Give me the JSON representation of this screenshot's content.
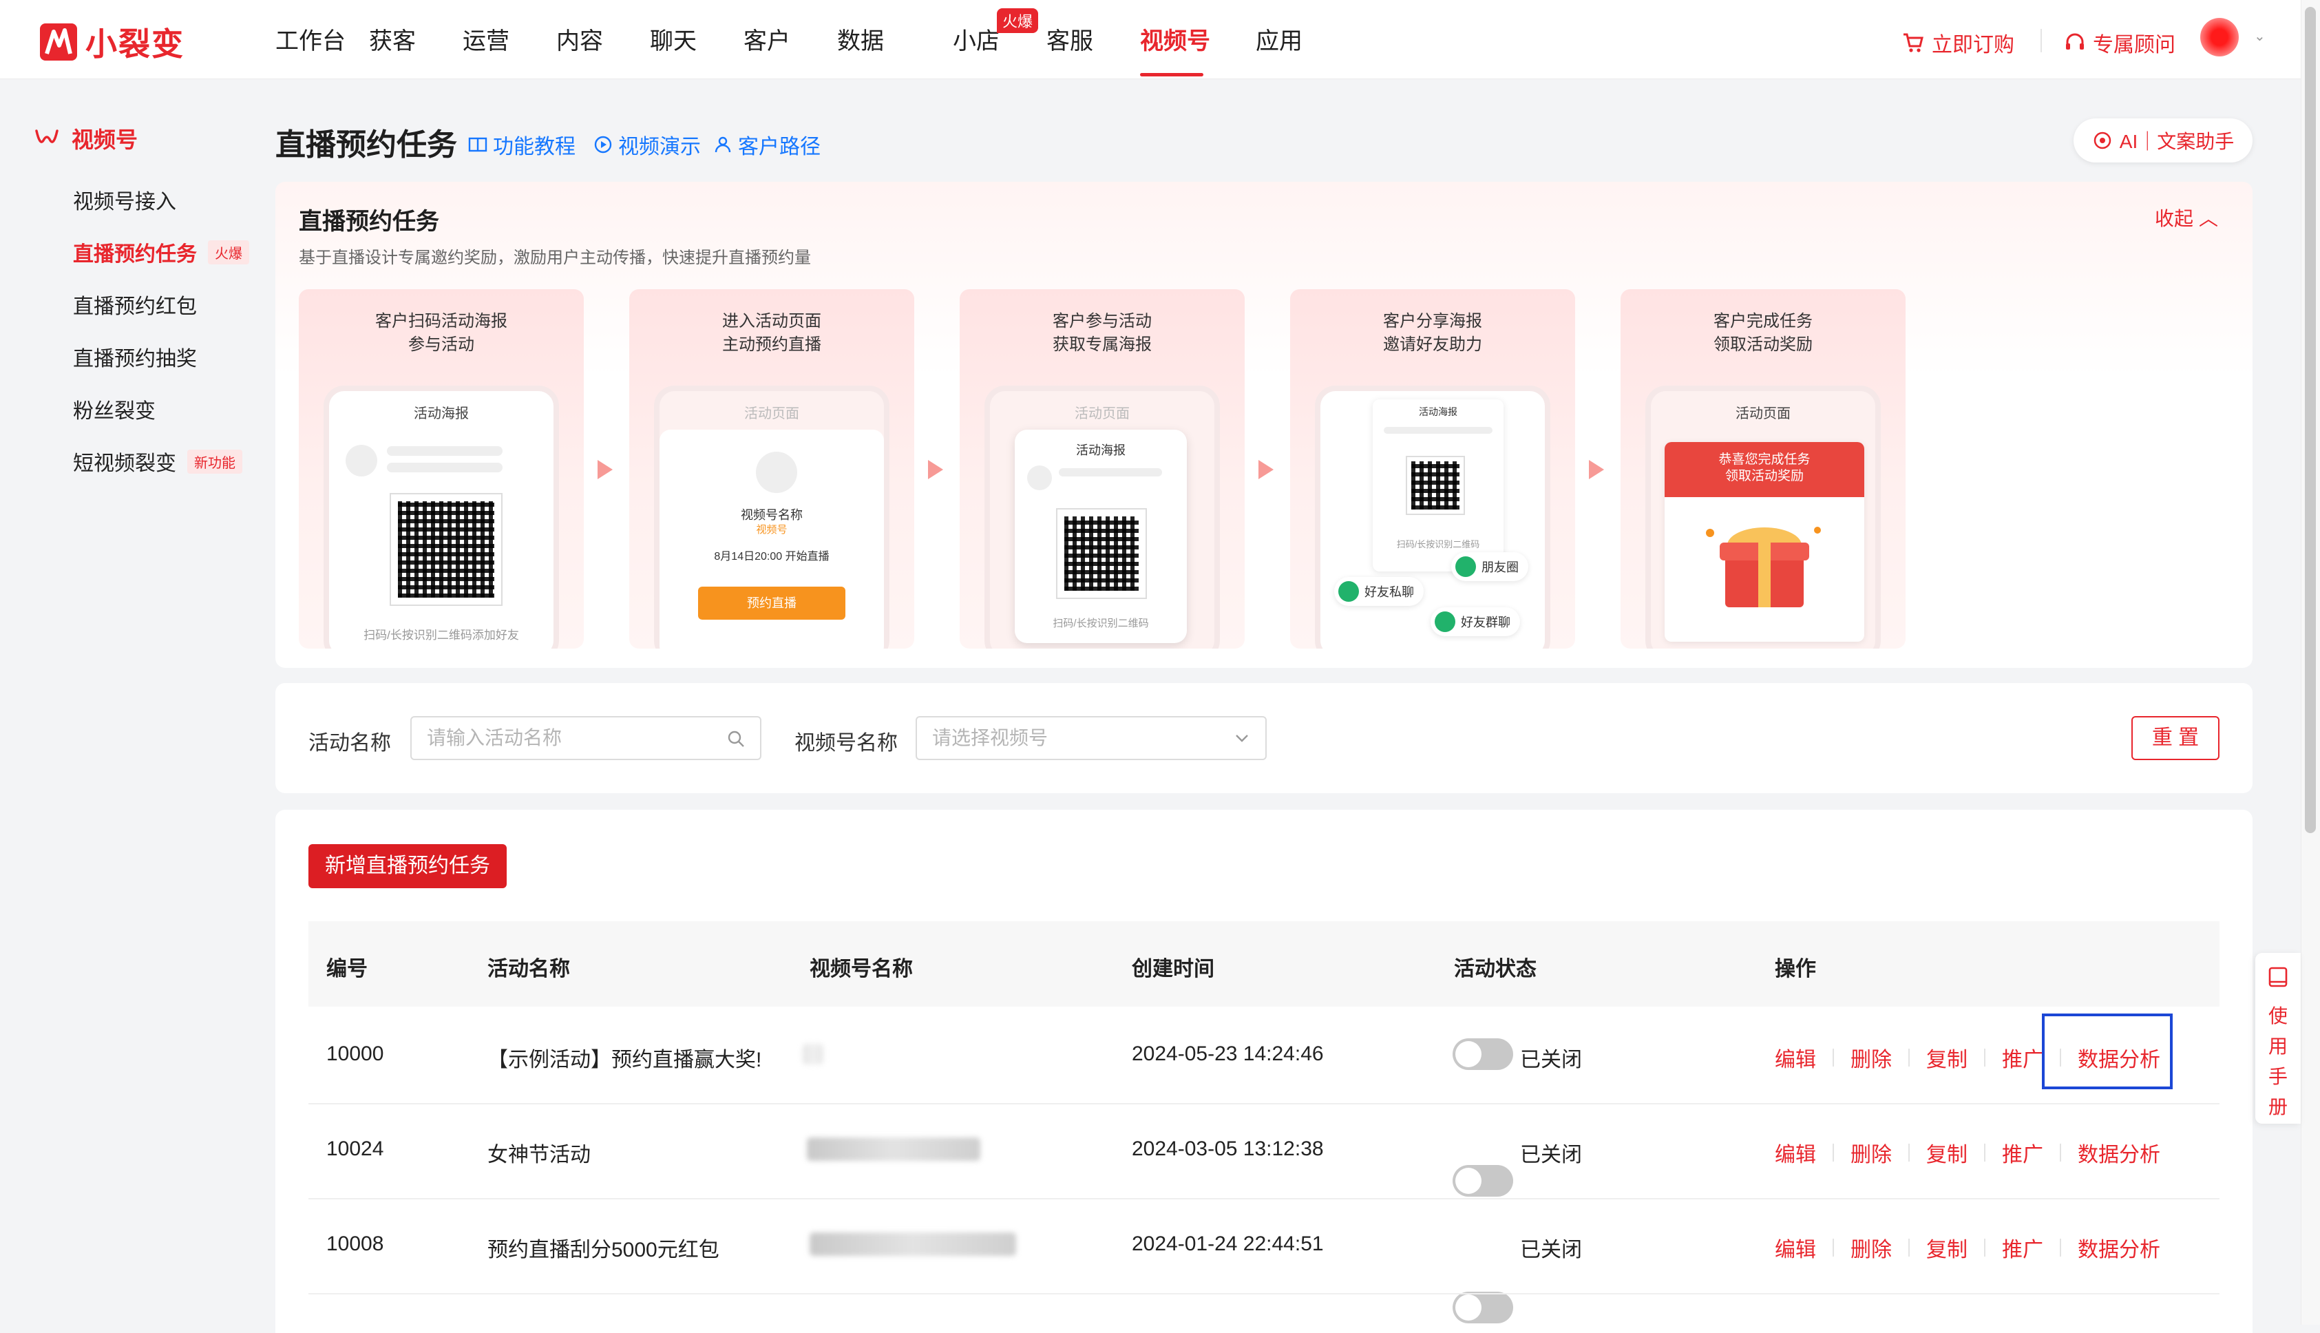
{
  "brand": {
    "name": "小裂变",
    "color": "#e8262d"
  },
  "nav": {
    "items": [
      "工作台",
      "获客",
      "运营",
      "内容",
      "聊天",
      "客户",
      "数据",
      "小店",
      "客服",
      "视频号",
      "应用"
    ],
    "active": "视频号",
    "hot_badge": "火爆"
  },
  "top_right": {
    "subscribe": "立即订购",
    "consultant": "专属顾问"
  },
  "sidebar": {
    "section": "视频号",
    "items": [
      {
        "label": "视频号接入",
        "tag": ""
      },
      {
        "label": "直播预约任务",
        "tag": "火爆",
        "active": true
      },
      {
        "label": "直播预约红包",
        "tag": ""
      },
      {
        "label": "直播预约抽奖",
        "tag": ""
      },
      {
        "label": "粉丝裂变",
        "tag": ""
      },
      {
        "label": "短视频裂变",
        "tag": "新功能"
      }
    ]
  },
  "header": {
    "title": "直播预约任务",
    "links": [
      "功能教程",
      "视频演示",
      "客户路径"
    ],
    "ai_button": "AI｜文案助手"
  },
  "banner": {
    "title": "直播预约任务",
    "desc": "基于直播设计专属邀约奖励，激励用户主动传播，快速提升直播预约量",
    "collapse": "收起",
    "steps": [
      {
        "line1": "客户扫码活动海报",
        "line2": "参与活动",
        "phone_title": "活动海报",
        "caption": "扫码/长按识别二维码添加好友"
      },
      {
        "line1": "进入活动页面",
        "line2": "主动预约直播",
        "phone_title": "活动页面",
        "channel_name": "视频号名称",
        "channel_sub": "视频号",
        "time": "8月14日20:00 开始直播",
        "button": "预约直播"
      },
      {
        "line1": "客户参与活动",
        "line2": "获取专属海报",
        "phone_title": "活动页面",
        "poster_title": "活动海报",
        "caption": "扫码/长按识别二维码"
      },
      {
        "line1": "客户分享海报",
        "line2": "邀请好友助力",
        "poster_title": "活动海报",
        "caption": "扫码/长按识别二维码",
        "bubbles": [
          "朋友圈",
          "好友私聊",
          "好友群聊"
        ]
      },
      {
        "line1": "客户完成任务",
        "line2": "领取活动奖励",
        "phone_title": "活动页面",
        "reward_l1": "恭喜您完成任务",
        "reward_l2": "领取活动奖励"
      }
    ]
  },
  "filter": {
    "activity_label": "活动名称",
    "activity_placeholder": "请输入活动名称",
    "channel_label": "视频号名称",
    "channel_placeholder": "请选择视频号",
    "reset": "重 置"
  },
  "table": {
    "add_button": "新增直播预约任务",
    "columns": [
      "编号",
      "活动名称",
      "视频号名称",
      "创建时间",
      "活动状态",
      "操作"
    ],
    "rows": [
      {
        "id": "10000",
        "name": "【示例活动】预约直播赢大奖!",
        "created": "2024-05-23 14:24:46",
        "status": "已关闭"
      },
      {
        "id": "10024",
        "name": "女神节活动",
        "created": "2024-03-05 13:12:38",
        "status": "已关闭"
      },
      {
        "id": "10008",
        "name": "预约直播刮分5000元红包",
        "created": "2024-01-24 22:44:51",
        "status": "已关闭"
      }
    ],
    "ops": [
      "编辑",
      "删除",
      "复制",
      "推广",
      "数据分析"
    ]
  },
  "manual": "使用手册"
}
